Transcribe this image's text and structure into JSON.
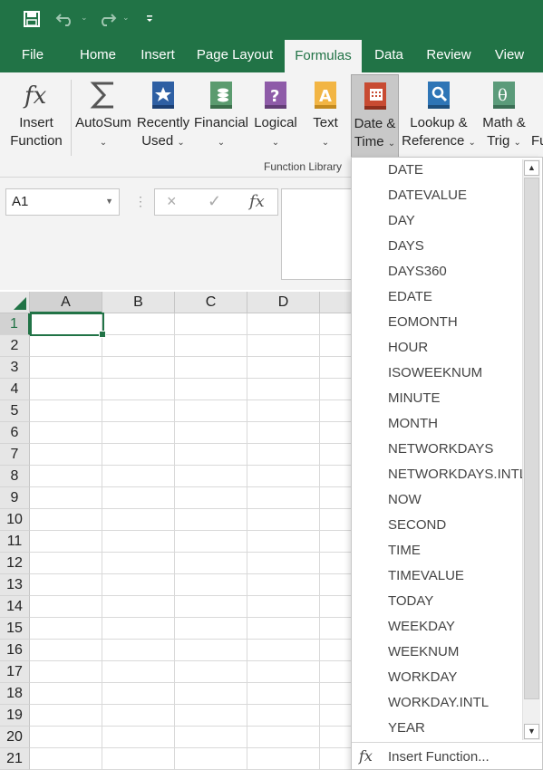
{
  "qat": {
    "save": "save-icon",
    "undo": "undo-icon",
    "redo": "redo-icon",
    "customize": "customize-icon"
  },
  "tabs": [
    "File",
    "Home",
    "Insert",
    "Page Layout",
    "Formulas",
    "Data",
    "Review",
    "View"
  ],
  "active_tab": "Formulas",
  "ribbon": {
    "insert_function": [
      "Insert",
      "Function"
    ],
    "autosum": "AutoSum",
    "recently_used": [
      "Recently",
      "Used"
    ],
    "financial": "Financial",
    "logical": "Logical",
    "text": "Text",
    "date_time": [
      "Date &",
      "Time"
    ],
    "lookup_reference": [
      "Lookup &",
      "Reference"
    ],
    "math_trig": [
      "Math &",
      "Trig"
    ],
    "more_functions": "Fu",
    "group_label": "Function Library",
    "colors": {
      "financial": "#5b9b6f",
      "logical": "#8e5ba8",
      "text": "#f2b544",
      "date_time": "#c84b32",
      "lookup": "#2e75b6",
      "math": "#5b9b7a",
      "recent": "#2e5fa3"
    }
  },
  "name_box": "A1",
  "formula_icons": {
    "cancel": "×",
    "enter": "✓",
    "fx": "fx"
  },
  "columns": [
    "A",
    "B",
    "C",
    "D"
  ],
  "rows": [
    "1",
    "2",
    "3",
    "4",
    "5",
    "6",
    "7",
    "8",
    "9",
    "10",
    "11",
    "12",
    "13",
    "14",
    "15",
    "16",
    "17",
    "18",
    "19",
    "20",
    "21"
  ],
  "active_cell": "A1",
  "dropdown": {
    "items": [
      "DATE",
      "DATEVALUE",
      "DAY",
      "DAYS",
      "DAYS360",
      "EDATE",
      "EOMONTH",
      "HOUR",
      "ISOWEEKNUM",
      "MINUTE",
      "MONTH",
      "NETWORKDAYS",
      "NETWORKDAYS.INTL",
      "NOW",
      "SECOND",
      "TIME",
      "TIMEVALUE",
      "TODAY",
      "WEEKDAY",
      "WEEKNUM",
      "WORKDAY",
      "WORKDAY.INTL",
      "YEAR"
    ],
    "footer_icon": "fx",
    "footer_label": "Insert Function..."
  },
  "brand_color": "#217346"
}
